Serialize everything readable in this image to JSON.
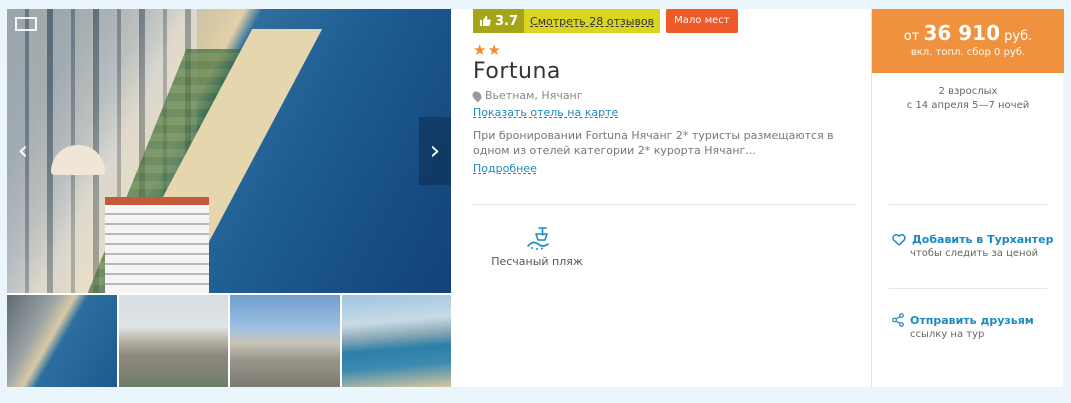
{
  "gallery": {
    "arrow_left": "‹",
    "arrow_right": "›"
  },
  "rating": {
    "score": "3.7",
    "reviews_link": "Смотреть 28 отзывов",
    "few_places": "Мало мест",
    "colors": {
      "score_bg": "#a5a51a",
      "reviews_bg": "#dcd51e",
      "few_places_bg": "#f05a28"
    }
  },
  "hotel": {
    "stars": "★★",
    "name": "Fortuna",
    "location": "Вьетнам, Нячанг",
    "map_link": "Показать отель на карте",
    "description": "При бронировании Fortuna Нячанг 2* туристы размещаются в одном из отелей категории 2* курорта Нячанг...",
    "more_link": "Подробнее",
    "feature": {
      "label": "Песчаный пляж",
      "icon": "sand-beach-icon"
    }
  },
  "price": {
    "prefix": "от",
    "amount": "36 910",
    "currency": "руб.",
    "fuel_note": "вкл. топл. сбор 0 руб.",
    "accent_color": "#f0923d"
  },
  "tour": {
    "people": "2 взрослых",
    "dates": "с 14 апреля 5—7 ночей"
  },
  "actions": {
    "add": {
      "label": "Добавить в Турхантер",
      "sub": "чтобы следить за ценой",
      "icon": "heart-icon"
    },
    "share": {
      "label": "Отправить друзьям",
      "sub": "ссылку на тур",
      "icon": "share-icon"
    }
  }
}
